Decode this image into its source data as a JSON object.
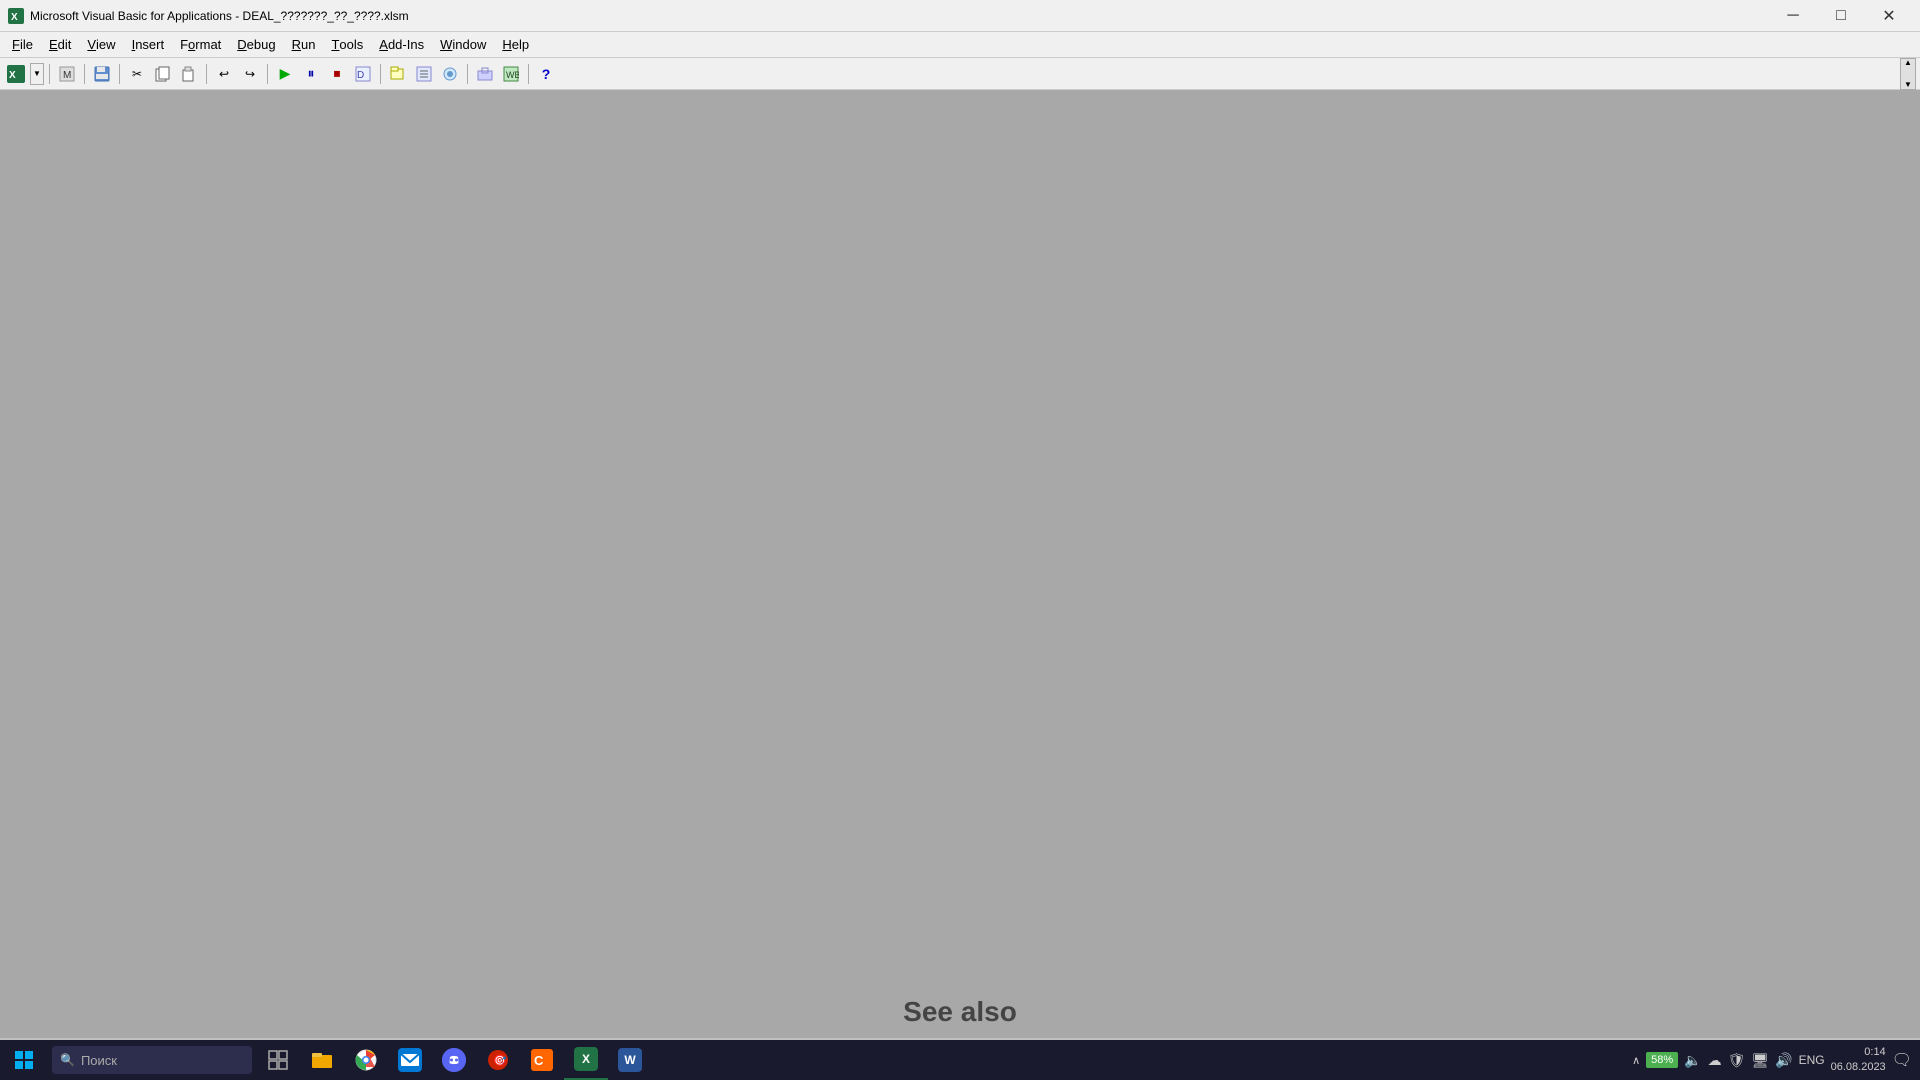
{
  "titlebar": {
    "icon": "📊",
    "title": "Microsoft Visual Basic for Applications - DEAL_???????_??_????.xlsm",
    "minimize_label": "─",
    "maximize_label": "□",
    "close_label": "✕"
  },
  "menubar": {
    "items": [
      {
        "id": "file",
        "label": "File",
        "underline_char": "F"
      },
      {
        "id": "edit",
        "label": "Edit",
        "underline_char": "E"
      },
      {
        "id": "view",
        "label": "View",
        "underline_char": "V"
      },
      {
        "id": "insert",
        "label": "Insert",
        "underline_char": "I"
      },
      {
        "id": "format",
        "label": "Format",
        "underline_char": "o"
      },
      {
        "id": "debug",
        "label": "Debug",
        "underline_char": "D"
      },
      {
        "id": "run",
        "label": "Run",
        "underline_char": "R"
      },
      {
        "id": "tools",
        "label": "Tools",
        "underline_char": "T"
      },
      {
        "id": "addins",
        "label": "Add-Ins",
        "underline_char": "A"
      },
      {
        "id": "window",
        "label": "Window",
        "underline_char": "W"
      },
      {
        "id": "help",
        "label": "Help",
        "underline_char": "H"
      }
    ]
  },
  "toolbar": {
    "buttons": [
      {
        "id": "excel-view",
        "icon": "📊",
        "tooltip": "View Excel"
      },
      {
        "id": "insert-form",
        "icon": "🗂",
        "tooltip": "Insert Form"
      },
      {
        "id": "save",
        "icon": "💾",
        "tooltip": "Save"
      },
      {
        "id": "cut",
        "icon": "✂",
        "tooltip": "Cut"
      },
      {
        "id": "copy",
        "icon": "📋",
        "tooltip": "Copy"
      },
      {
        "id": "paste",
        "icon": "📌",
        "tooltip": "Paste"
      },
      {
        "id": "undo",
        "icon": "↩",
        "tooltip": "Undo"
      },
      {
        "id": "redo",
        "icon": "↪",
        "tooltip": "Redo"
      },
      {
        "id": "run",
        "icon": "▶",
        "tooltip": "Run"
      },
      {
        "id": "break",
        "icon": "⏸",
        "tooltip": "Break"
      },
      {
        "id": "reset",
        "icon": "⏹",
        "tooltip": "Reset"
      },
      {
        "id": "design",
        "icon": "📐",
        "tooltip": "Design Mode"
      },
      {
        "id": "project-explorer",
        "icon": "📁",
        "tooltip": "Project Explorer"
      },
      {
        "id": "properties",
        "icon": "🔧",
        "tooltip": "Properties"
      },
      {
        "id": "object-browser",
        "icon": "🔍",
        "tooltip": "Object Browser"
      },
      {
        "id": "toolbox",
        "icon": "🧰",
        "tooltip": "Toolbox"
      },
      {
        "id": "help",
        "icon": "❓",
        "tooltip": "Help"
      }
    ]
  },
  "main_area": {
    "background_color": "#a0a0a0"
  },
  "see_also_text": "See also",
  "taskbar": {
    "search_placeholder": "Поиск",
    "apps": [
      {
        "id": "task-view",
        "icon": "⊞",
        "tooltip": "Task View"
      },
      {
        "id": "file-explorer",
        "icon": "📁",
        "tooltip": "File Explorer",
        "color": "#f0a800"
      },
      {
        "id": "chrome",
        "icon": "🌐",
        "tooltip": "Google Chrome"
      },
      {
        "id": "app-mail",
        "icon": "✉",
        "tooltip": "Mail",
        "color": "#0078d4"
      },
      {
        "id": "discord",
        "icon": "💬",
        "tooltip": "Discord",
        "color": "#5865f2"
      },
      {
        "id": "app-red",
        "icon": "🎯",
        "tooltip": "App",
        "color": "#cc0000"
      },
      {
        "id": "app-orange",
        "icon": "📊",
        "tooltip": "App2",
        "color": "#ff6600"
      },
      {
        "id": "excel",
        "icon": "X",
        "tooltip": "Excel",
        "color": "#217346"
      },
      {
        "id": "word",
        "icon": "W",
        "tooltip": "Word",
        "color": "#2b579a"
      }
    ],
    "system_tray": {
      "battery": "58%",
      "language": "ENG",
      "time": "0:14",
      "date": "06.08.2023"
    }
  }
}
